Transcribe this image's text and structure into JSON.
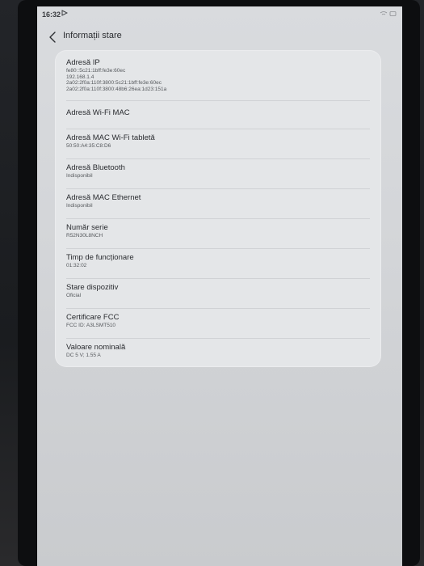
{
  "status_bar": {
    "time": "16:32",
    "cast_icon": "play-outline-icon",
    "right_icons": "wifi-icon battery-icon"
  },
  "header": {
    "back_icon": "chevron-left-icon",
    "title": "Informații stare"
  },
  "items": [
    {
      "title": "Adresă IP",
      "values": [
        "fe80::5c21:1bff:fe3e:60ec",
        "192.168.1.4",
        "2a02:2f0a:110f:3800:5c21:1bff:fe3e:60ec",
        "2a02:2f0a:110f:3800:48b6:26ea:1d23:151a"
      ]
    },
    {
      "title": "Adresă Wi-Fi MAC",
      "values": []
    },
    {
      "title": "Adresă MAC Wi-Fi tabletă",
      "values": [
        "50:50:A4:35:C8:D6"
      ]
    },
    {
      "title": "Adresă Bluetooth",
      "values": [
        "Indisponibil"
      ]
    },
    {
      "title": "Adresă MAC Ethernet",
      "values": [
        "Indisponibil"
      ]
    },
    {
      "title": "Număr serie",
      "values": [
        "R52N30L8NCH"
      ]
    },
    {
      "title": "Timp de funcționare",
      "values": [
        "01:32:02"
      ]
    },
    {
      "title": "Stare dispozitiv",
      "values": [
        "Oficial"
      ]
    },
    {
      "title": "Certificare FCC",
      "values": [
        "FCC ID: A3LSMT510"
      ]
    },
    {
      "title": "Valoare nominală",
      "values": [
        "DC 5 V; 1.55 A"
      ]
    }
  ]
}
